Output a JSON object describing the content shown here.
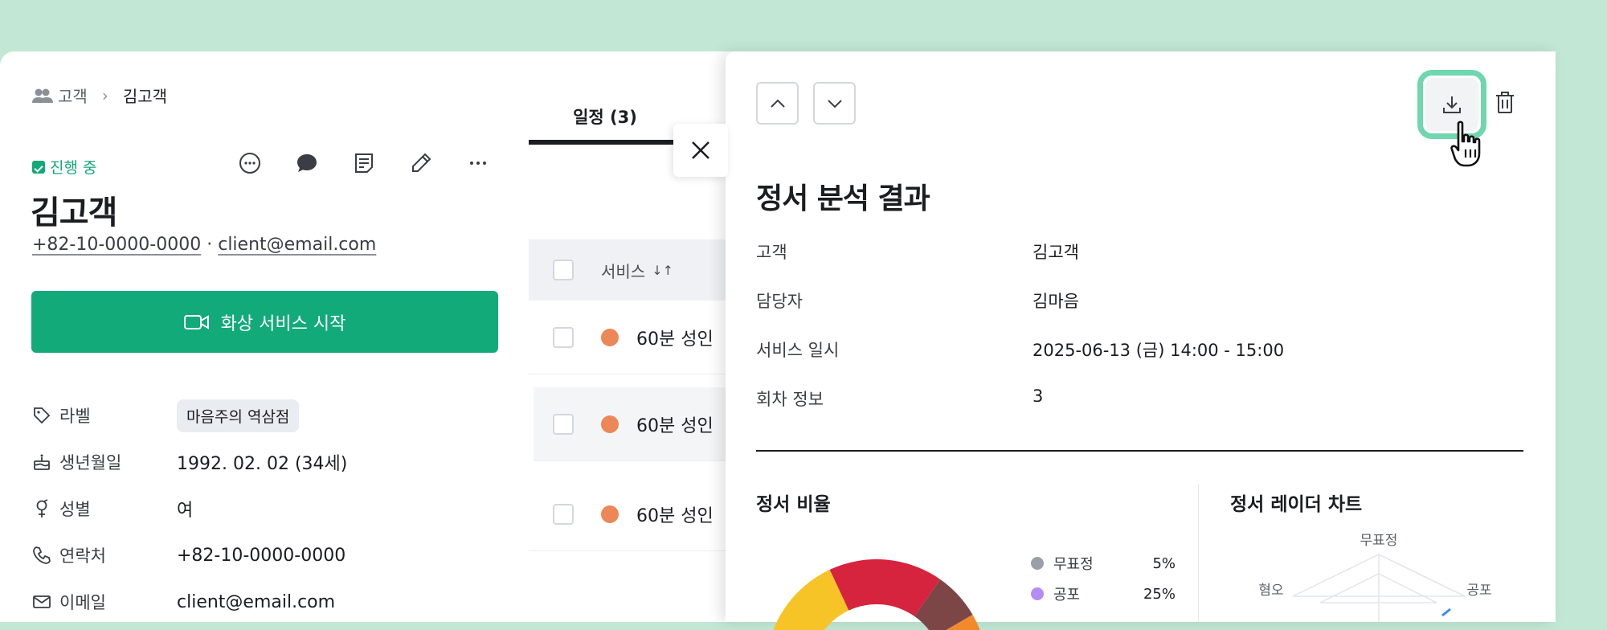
{
  "breadcrumb": {
    "parent": "고객",
    "current": "김고객"
  },
  "client": {
    "status": "진행 중",
    "name": "김고객",
    "phone": "+82-10-0000-0000",
    "separator": "·",
    "email": "client@email.com",
    "video_button": "화상 서비스 시작",
    "fields": [
      {
        "key": "라벨",
        "value": "마음주의 역삼점",
        "icon": "tag-icon"
      },
      {
        "key": "생년월일",
        "value": "1992. 02. 02 (34세)",
        "icon": "cake-icon"
      },
      {
        "key": "성별",
        "value": "여",
        "icon": "gender-icon"
      },
      {
        "key": "연락처",
        "value": "+82-10-0000-0000",
        "icon": "phone-icon"
      },
      {
        "key": "이메일",
        "value": "client@email.com",
        "icon": "mail-icon"
      }
    ]
  },
  "schedule": {
    "tab_label": "일정 (3)",
    "header_label": "서비스",
    "sort_icon": "↓↑",
    "items": [
      "60분 성인",
      "60분 성인",
      "60분 성인"
    ],
    "dot_color": "#ec8757"
  },
  "drawer": {
    "title": "정서 분석 결과",
    "info": [
      {
        "key": "고객",
        "value": "김고객"
      },
      {
        "key": "담당자",
        "value": "김마음"
      },
      {
        "key": "서비스 일시",
        "value": "2025-06-13 (금) 14:00 - 15:00"
      },
      {
        "key": "회차 정보",
        "value": "3"
      }
    ],
    "ratio_title": "정서 비율",
    "radar_title": "정서 레이더 차트"
  },
  "chart_data": [
    {
      "type": "pie",
      "title": "정서 비율",
      "legend": [
        {
          "name": "무표정",
          "value": 5,
          "label": "5%",
          "color": "#9aa0aa"
        },
        {
          "name": "공포",
          "value": 25,
          "label": "25%",
          "color": "#b48cf5"
        }
      ],
      "visible_slice_colors": [
        "#f6c427",
        "#d6233e",
        "#7d4646",
        "#f28a2c"
      ]
    },
    {
      "type": "radar",
      "title": "정서 레이더 차트",
      "axes": [
        "무표정",
        "공포",
        "혐오"
      ],
      "series_color": "#3b8fe8"
    }
  ],
  "colors": {
    "accent": "#13aa79",
    "status": "#12a877",
    "highlight": "#6fd7ad"
  }
}
